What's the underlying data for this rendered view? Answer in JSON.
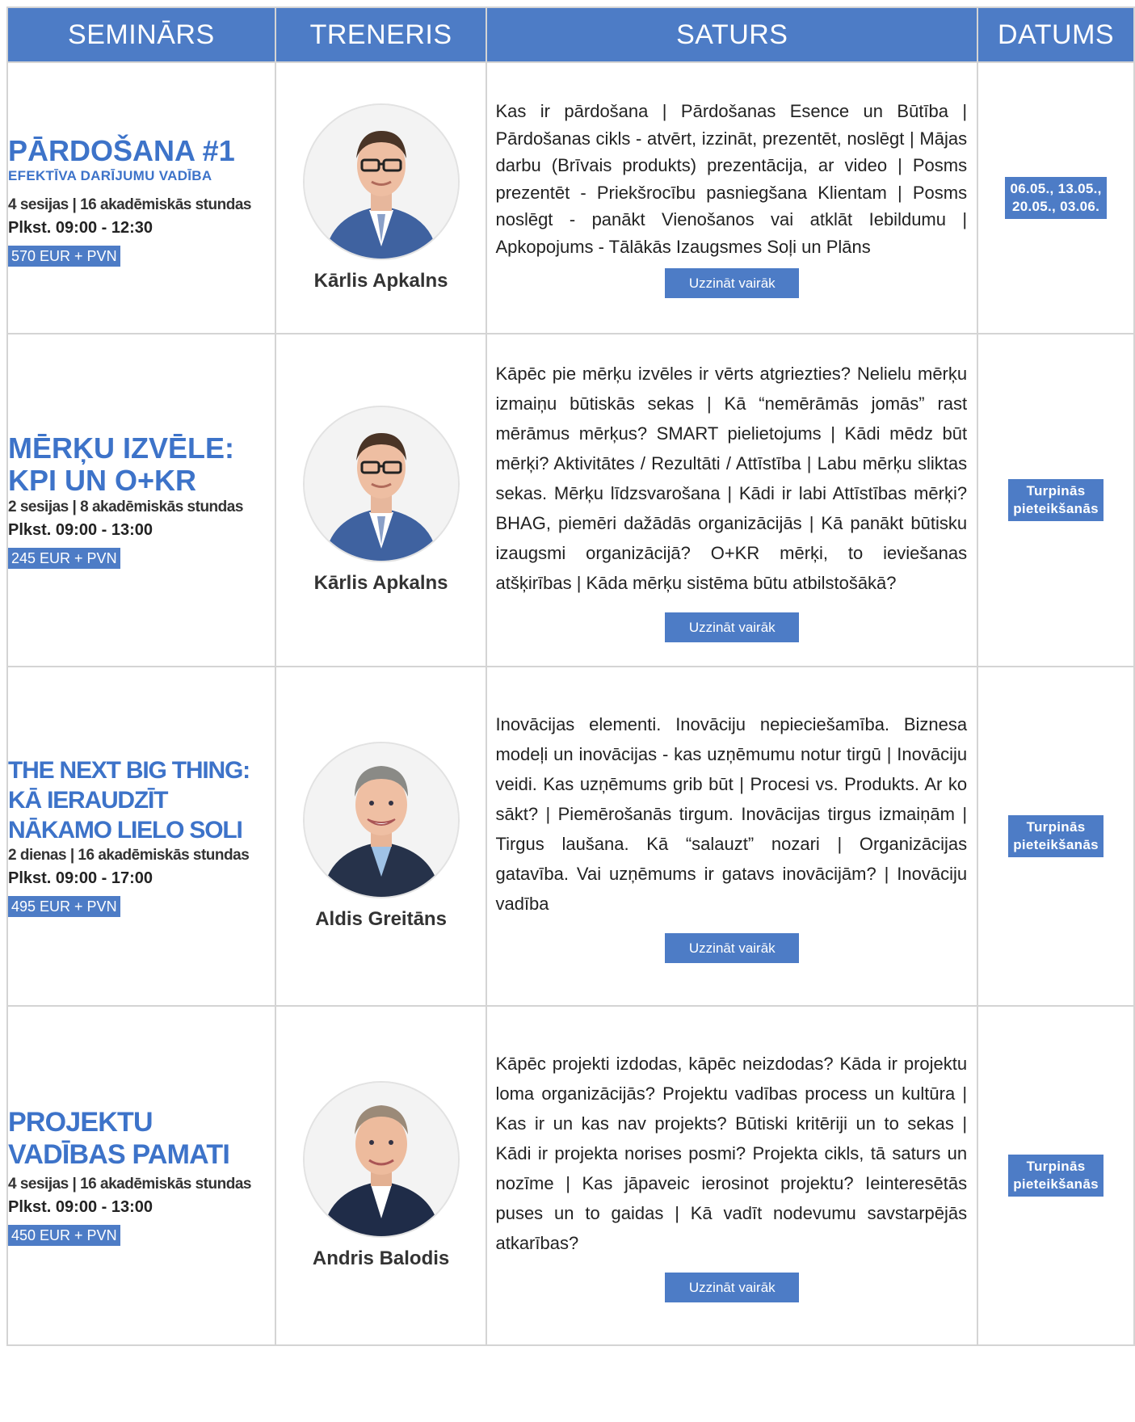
{
  "header": {
    "col1": "SEMINĀRS",
    "col2": "TRENERIS",
    "col3": "SATURS",
    "col4": "DATUMS"
  },
  "more_label": "Uzzināt vairāk",
  "colors": {
    "accent": "#4d7cc6",
    "title": "#3d73c9",
    "border": "#d4d4d4"
  },
  "rows": [
    {
      "title": "PĀRDOŠANA #1",
      "subtitle": "EFEKTĪVA DARĪJUMU VADĪBA",
      "meta": "4 sesijas | 16 akadēmiskās stundas",
      "time": "Plkst. 09:00 - 12:30",
      "price": "570 EUR + PVN",
      "trainer": "Kārlis Apkalns",
      "content": "Kas ir pārdošana | Pārdošanas Esence un Būtība | Pārdošanas cikls - atvērt, izzināt, prezentēt, noslēgt | Mājas darbu (Brīvais produkts) prezentācija, ar video | Posms prezentēt - Priekšrocību pasniegšana Klientam | Posms noslēgt - panākt Vienošanos vai atklāt Iebildumu | Apkopojums - Tālākās Izaugsmes Soļi un Plāns",
      "date_line1": "06.05., 13.05.,",
      "date_line2": "20.05., 03.06."
    },
    {
      "title_line1": "MĒRĶU IZVĒLE:",
      "title_line2": "KPI UN O+KR",
      "meta": "2 sesijas | 8 akadēmiskās stundas",
      "time": "Plkst. 09:00 - 13:00",
      "price": "245 EUR + PVN",
      "trainer": "Kārlis Apkalns",
      "content": "Kāpēc pie mērķu izvēles ir vērts atgriezties? Nelielu mērķu izmaiņu būtiskās sekas | Kā “nemērāmās jomās” rast mērāmus mērķus? SMART pielietojums | Kādi mēdz būt mērķi? Aktivitātes / Rezultāti / Attīstība | Labu mērķu sliktas sekas. Mērķu līdzsvarošana | Kādi ir labi Attīstības mērķi? BHAG, piemēri dažādās organizācijās | Kā panākt būtisku izaugsmi organizācijā? O+KR mērķi, to ieviešanas atšķirības | Kāda mērķu sistēma būtu atbilstošākā?",
      "date_line1": "Turpinās",
      "date_line2": "pieteikšanās"
    },
    {
      "title_line1": "THE NEXT BIG THING:",
      "title_line2": "KĀ IERAUDZĪT",
      "title_line3": "NĀKAMO LIELO SOLI",
      "meta": "2 dienas | 16 akadēmiskās stundas",
      "time": "Plkst. 09:00 - 17:00",
      "price": "495 EUR + PVN",
      "trainer": "Aldis Greitāns",
      "content": "Inovācijas elementi. Inovāciju nepieciešamība. Biznesa modeļi un inovācijas - kas uzņēmumu notur tirgū | Inovāciju veidi. Kas uzņēmums grib būt | Procesi vs. Produkts. Ar ko sākt? | Piemērošanās tirgum. Inovācijas tirgus izmaiņām | Tirgus laušana. Kā “salauzt” nozari | Organizācijas gatavība. Vai uzņēmums ir gatavs inovācijām? | Inovāciju vadība",
      "date_line1": "Turpinās",
      "date_line2": "pieteikšanās"
    },
    {
      "title_line1": "PROJEKTU",
      "title_line2": "VADĪBAS PAMATI",
      "meta": "4 sesijas | 16 akadēmiskās stundas",
      "time": "Plkst. 09:00 - 13:00",
      "price": "450 EUR + PVN",
      "trainer": "Andris Balodis",
      "content": "Kāpēc projekti izdodas, kāpēc neizdodas? Kāda ir projektu loma organizācijās? Projektu vadības process un kultūra | Kas ir un kas nav projekts? Būtiski kritēriji un to sekas | Kādi ir projekta norises posmi? Projekta cikls, tā saturs un nozīme | Kas jāpaveic ierosinot projektu? Ieinteresētās puses un to gaidas  | Kā vadīt nodevumu savstarpējās atkarības?",
      "date_line1": "Turpinās",
      "date_line2": "pieteikšanās"
    }
  ]
}
